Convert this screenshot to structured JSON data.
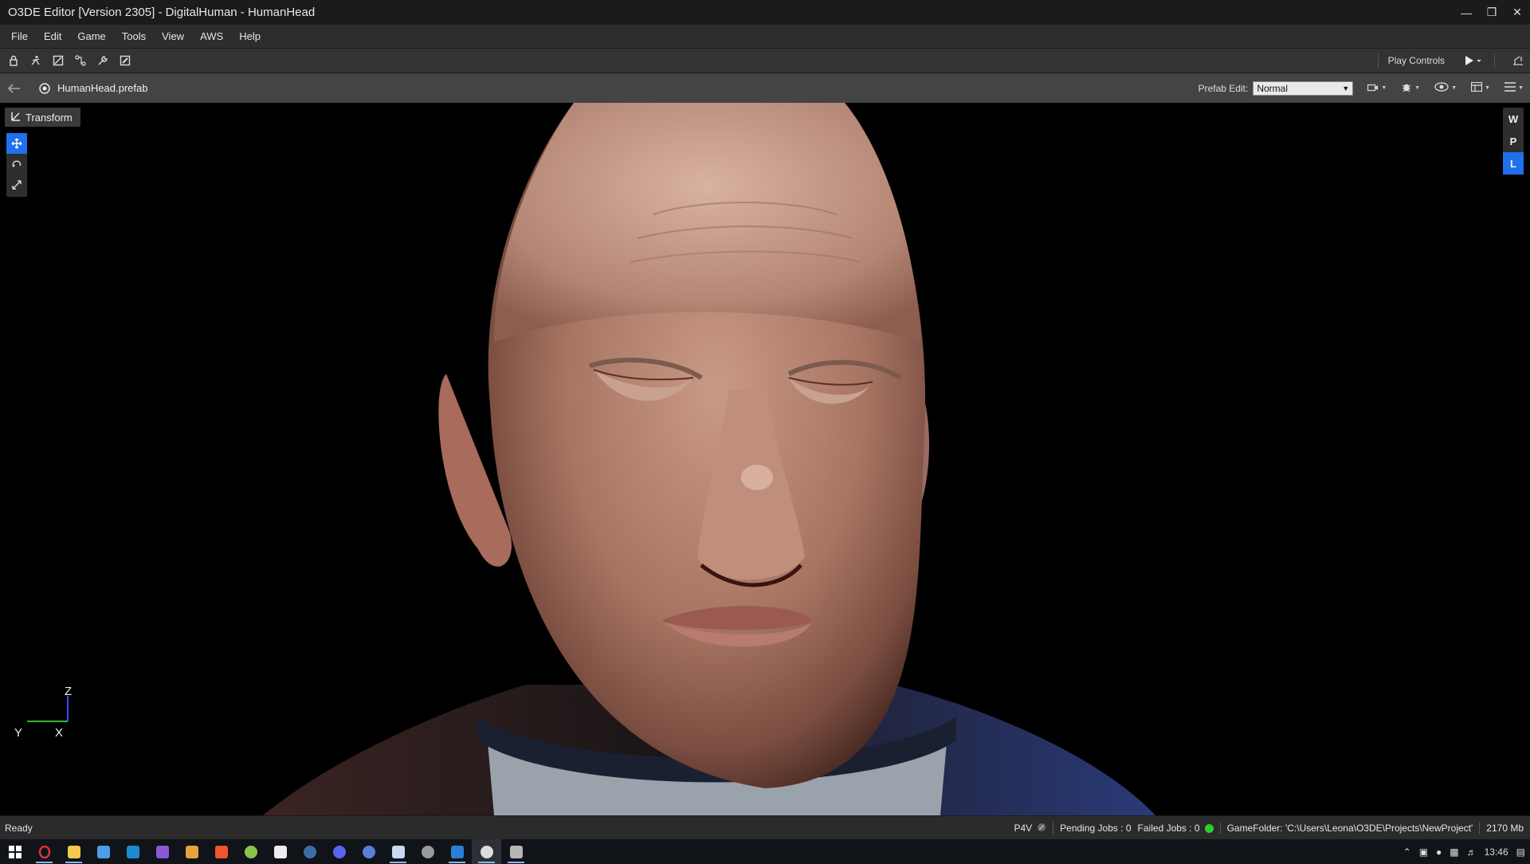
{
  "window": {
    "title": "O3DE Editor [Version 2305] - DigitalHuman - HumanHead"
  },
  "menu": {
    "items": [
      "File",
      "Edit",
      "Game",
      "Tools",
      "View",
      "AWS",
      "Help"
    ]
  },
  "toolbar": {
    "play_controls_label": "Play Controls"
  },
  "breadcrumb": {
    "prefab_name": "HumanHead.prefab",
    "prefab_edit_label": "Prefab Edit:",
    "prefab_edit_value": "Normal"
  },
  "viewport": {
    "transform_label": "Transform",
    "wpl": [
      "W",
      "P",
      "L"
    ],
    "axis": {
      "z": "Z",
      "y": "Y",
      "x": "X"
    }
  },
  "status": {
    "ready": "Ready",
    "p4v": "P4V",
    "pending_jobs": "Pending Jobs : 0",
    "failed_jobs": "Failed Jobs : 0",
    "game_folder": "GameFolder: 'C:\\Users\\Leona\\O3DE\\Projects\\NewProject'",
    "memory": "2170 Mb"
  },
  "taskbar": {
    "time": "13:46"
  },
  "colors": {
    "accent": "#1e70eb",
    "status_ok": "#2bd12b"
  }
}
